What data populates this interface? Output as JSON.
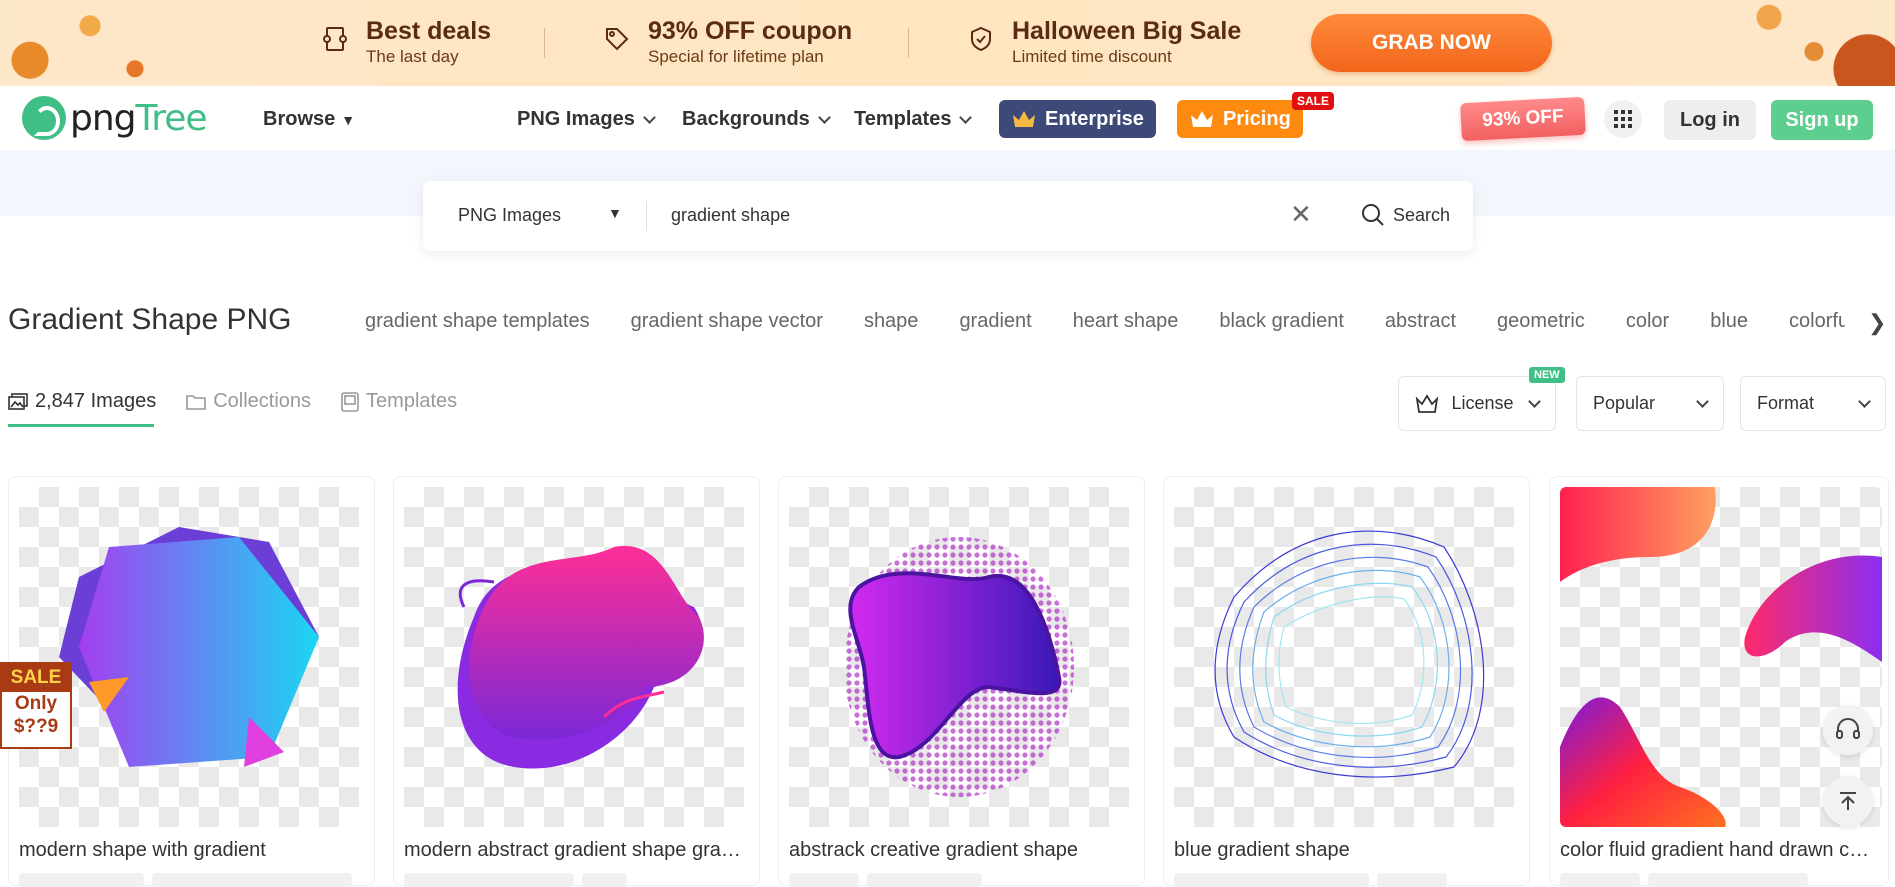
{
  "promo": {
    "deals": [
      {
        "title": "Best deals",
        "sub": "The last day",
        "icon": "ticket-icon"
      },
      {
        "title": "93% OFF coupon",
        "sub": "Special for lifetime plan",
        "icon": "tag-icon"
      },
      {
        "title": "Halloween Big Sale",
        "sub": "Limited time discount",
        "icon": "shield-icon"
      }
    ],
    "cta": "GRAB NOW"
  },
  "nav": {
    "logo_a": "png",
    "logo_b": "Tree",
    "browse": "Browse",
    "links": [
      "PNG Images",
      "Backgrounds",
      "Templates"
    ],
    "enterprise": "Enterprise",
    "pricing": "Pricing",
    "sale_tag": "SALE",
    "off_badge": "93% OFF",
    "login": "Log in",
    "signup": "Sign up"
  },
  "search": {
    "type": "PNG Images",
    "query": "gradient shape",
    "button": "Search"
  },
  "page": {
    "title": "Gradient Shape PNG",
    "chips": [
      "gradient shape templates",
      "gradient shape vector",
      "shape",
      "gradient",
      "heart shape",
      "black gradient",
      "abstract",
      "geometric",
      "color",
      "blue",
      "colorful"
    ],
    "tabs": [
      {
        "label": "2,847 Images",
        "icon": "images-icon"
      },
      {
        "label": "Collections",
        "icon": "folder-icon"
      },
      {
        "label": "Templates",
        "icon": "template-icon"
      }
    ],
    "filters": {
      "license": "License",
      "new_tag": "NEW",
      "sort": "Popular",
      "format": "Format"
    }
  },
  "cards": [
    {
      "title": "modern shape with gradient"
    },
    {
      "title": "modern abstract gradient shape graphic"
    },
    {
      "title": "abstrack creative gradient shape"
    },
    {
      "title": "blue gradient shape"
    },
    {
      "title": "color fluid gradient hand drawn collection"
    }
  ],
  "sale_badge": {
    "label": "SALE",
    "line1": "Only",
    "line2": "$??9"
  },
  "colors": {
    "accent": "#3fbf86",
    "grab": "#f2661c",
    "enterprise": "#3d4a78",
    "pricing": "#ff8a10"
  }
}
